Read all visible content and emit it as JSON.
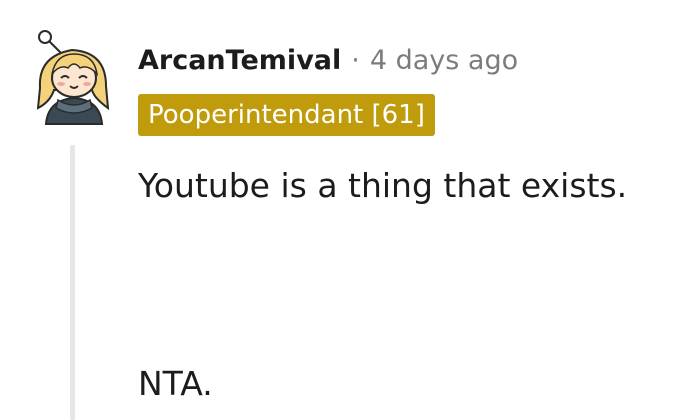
{
  "comment": {
    "username": "ArcanTemival",
    "separator": "·",
    "timestamp": "4 days ago",
    "flair": "Pooperintendant [61]",
    "body_lines": [
      "Youtube is a thing that exists.",
      "NTA."
    ],
    "avatar_icon": "snoo-avatar-icon"
  },
  "colors": {
    "flair_background": "#c09b0c",
    "text": "#1c1c1c",
    "muted": "#7c7c7c",
    "thread_line": "#e4e6e8"
  }
}
